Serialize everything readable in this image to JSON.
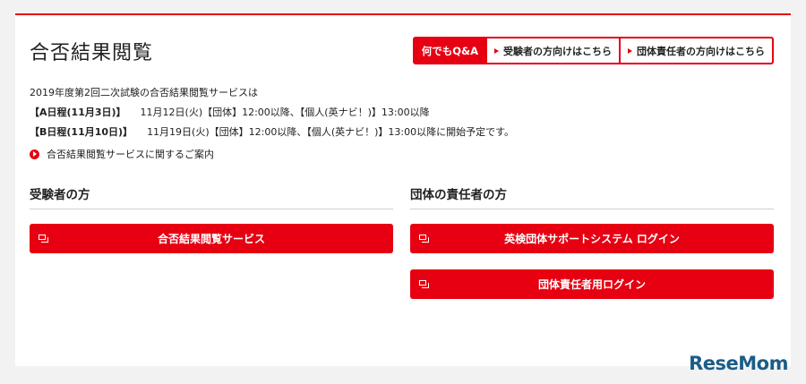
{
  "page": {
    "title": "合否結果閲覧"
  },
  "topnav": {
    "qa_label": "何でもQ&A",
    "examinee_label": "受験者の方向けはこちら",
    "group_label": "団体責任者の方向けはこちら"
  },
  "info": {
    "intro": "2019年度第2回二次試験の合否結果閲覧サービスは",
    "a_label": "【A日程(11月3日)】",
    "a_text": "11月12日(火)【団体】12:00以降、【個人(英ナビ！)】13:00以降",
    "b_label": "【B日程(11月10日)】",
    "b_text": "11月19日(火)【団体】12:00以降、【個人(英ナビ！)】13:00以降に開始予定です。"
  },
  "guide_link": "合否結果閲覧サービスに関するご案内",
  "examinee": {
    "heading": "受験者の方",
    "button": "合否結果閲覧サービス"
  },
  "group": {
    "heading": "団体の責任者の方",
    "button1": "英検団体サポートシステム ログイン",
    "button2": "団体責任者用ログイン"
  },
  "watermark": "ReseMom",
  "colors": {
    "accent": "#e60012",
    "logo": "#1b5d86"
  }
}
